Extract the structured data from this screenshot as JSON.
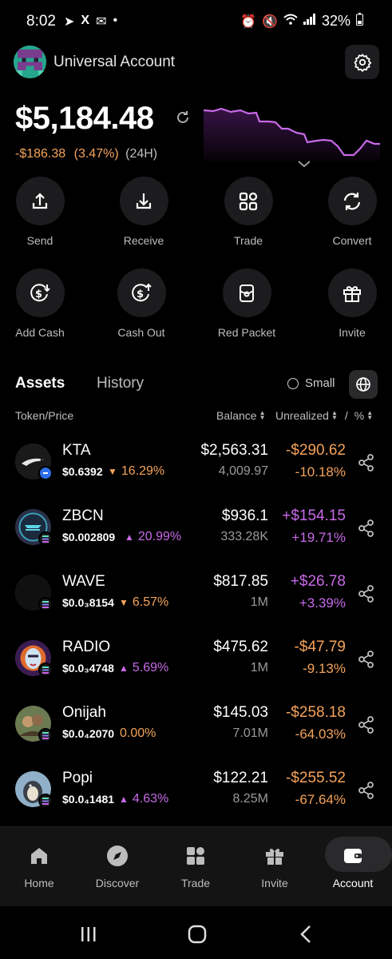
{
  "status_bar": {
    "time": "8:02",
    "battery": "32%"
  },
  "header": {
    "title": "Universal Account"
  },
  "balance": {
    "total": "$5,184.48",
    "change_amount": "-$186.38",
    "change_percent": "(3.47%)",
    "period": "(24H)"
  },
  "colors": {
    "negative": "#f5a35b",
    "positive": "#c86ae8",
    "surface": "#1c1c1e",
    "background": "#000000"
  },
  "actions": [
    {
      "label": "Send",
      "icon": "send-arrow-up-icon"
    },
    {
      "label": "Receive",
      "icon": "receive-arrow-down-icon"
    },
    {
      "label": "Trade",
      "icon": "trade-grid-icon"
    },
    {
      "label": "Convert",
      "icon": "convert-refresh-icon"
    },
    {
      "label": "Add Cash",
      "icon": "add-cash-icon"
    },
    {
      "label": "Cash Out",
      "icon": "cash-out-icon"
    },
    {
      "label": "Red Packet",
      "icon": "red-packet-icon"
    },
    {
      "label": "Invite",
      "icon": "gift-icon"
    }
  ],
  "tabs": {
    "assets": "Assets",
    "history": "History",
    "small_label": "Small"
  },
  "columns": {
    "token_price": "Token/Price",
    "balance": "Balance",
    "unrealized": "Unrealized",
    "slash": "/",
    "percent": "%"
  },
  "assets": [
    {
      "symbol": "KTA",
      "price": "$0.6392",
      "change": "16.29%",
      "direction": "down",
      "usd": "$2,563.31",
      "amount": "4,009.97",
      "pnl": "-$290.62",
      "pnl_pct": "-10.18%",
      "pnl_sign": "neg"
    },
    {
      "symbol": "ZBCN",
      "price": "$0.002809",
      "change": "20.99%",
      "direction": "up",
      "usd": "$936.1",
      "amount": "333.28K",
      "pnl": "+$154.15",
      "pnl_pct": "+19.71%",
      "pnl_sign": "pos"
    },
    {
      "symbol": "WAVE",
      "price": "$0.0₃8154",
      "change": "6.57%",
      "direction": "down",
      "usd": "$817.85",
      "amount": "1M",
      "pnl": "+$26.78",
      "pnl_pct": "+3.39%",
      "pnl_sign": "pos"
    },
    {
      "symbol": "RADIO",
      "price": "$0.0₃4748",
      "change": "5.69%",
      "direction": "up",
      "usd": "$475.62",
      "amount": "1M",
      "pnl": "-$47.79",
      "pnl_pct": "-9.13%",
      "pnl_sign": "neg"
    },
    {
      "symbol": "Onijah",
      "price": "$0.0₄2070",
      "change": "0.00%",
      "direction": "none",
      "usd": "$145.03",
      "amount": "7.01M",
      "pnl": "-$258.18",
      "pnl_pct": "-64.03%",
      "pnl_sign": "neg"
    },
    {
      "symbol": "Popi",
      "price": "$0.0₄1481",
      "change": "4.63%",
      "direction": "up",
      "usd": "$122.21",
      "amount": "8.25M",
      "pnl": "-$255.52",
      "pnl_pct": "-67.64%",
      "pnl_sign": "neg"
    }
  ],
  "nav": [
    {
      "label": "Home",
      "icon": "home-icon"
    },
    {
      "label": "Discover",
      "icon": "compass-icon"
    },
    {
      "label": "Trade",
      "icon": "trade-icon"
    },
    {
      "label": "Invite",
      "icon": "gift-icon"
    },
    {
      "label": "Account",
      "icon": "wallet-icon",
      "active": true
    }
  ]
}
